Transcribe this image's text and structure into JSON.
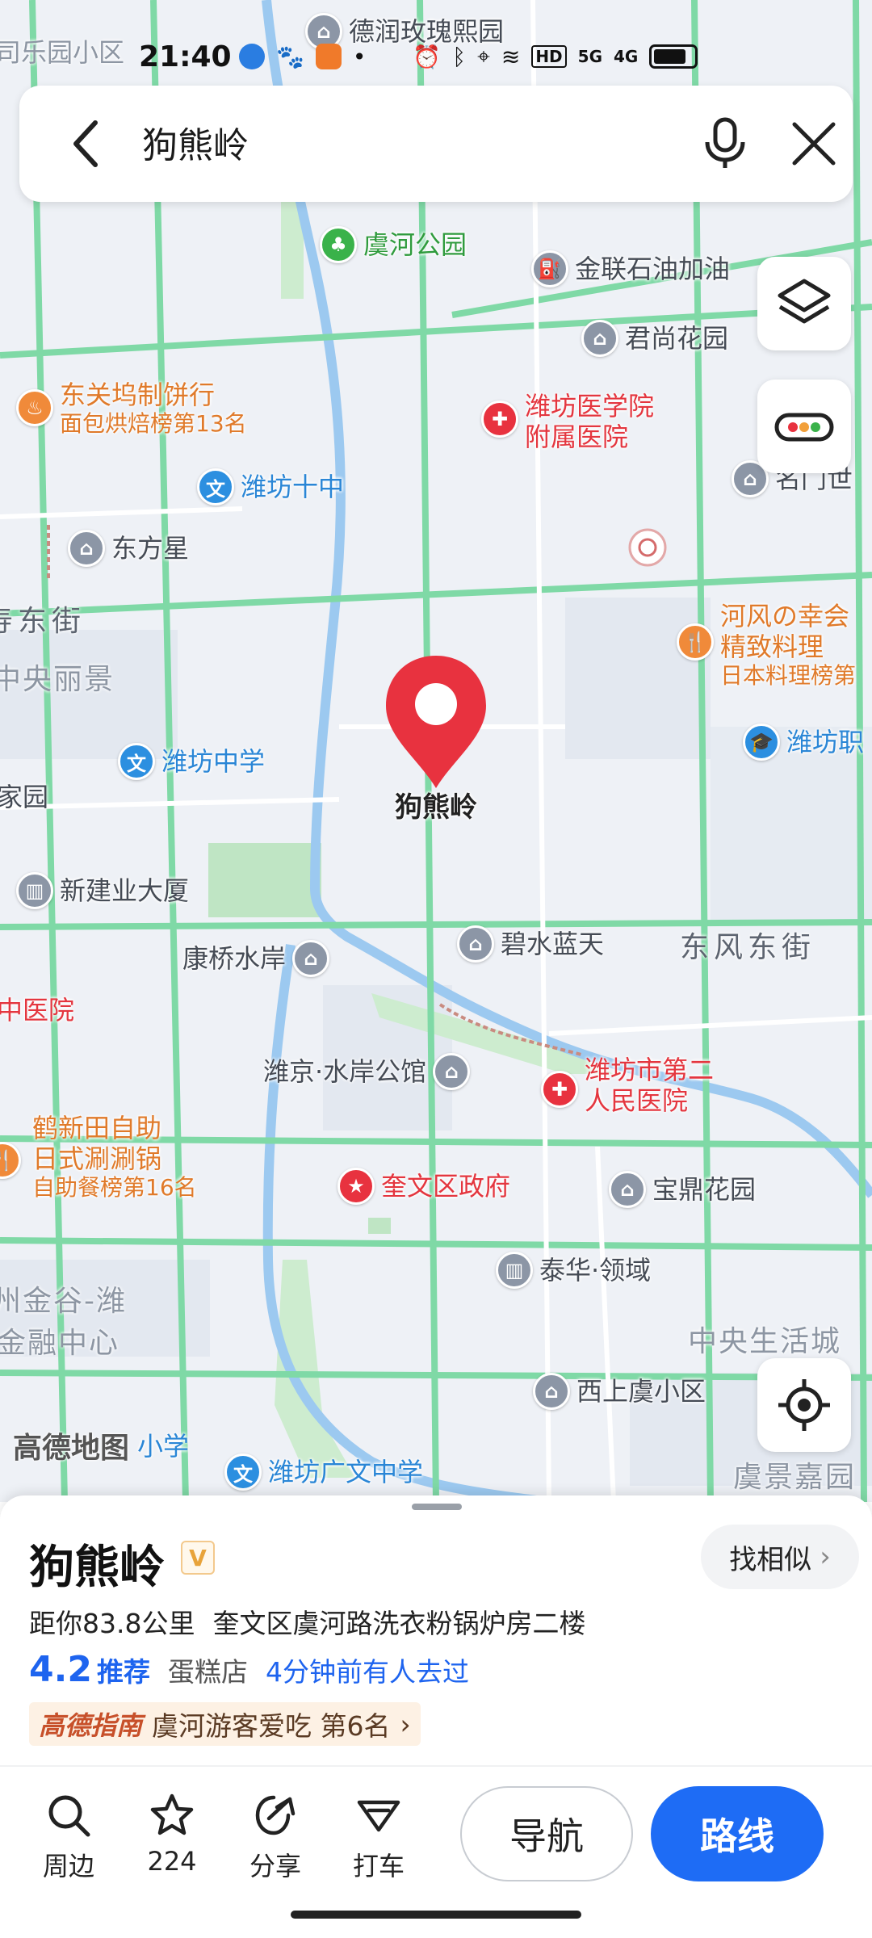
{
  "status_bar": {
    "time": "21:40",
    "icons": [
      "app-icon-1",
      "paw-icon",
      "app-icon-2",
      "dot-icon",
      "alarm-icon",
      "bluetooth-icon",
      "location-icon",
      "wifi-icon",
      "hd-icon",
      "signal-5g-icon",
      "signal-4g-icon",
      "battery-icon"
    ],
    "hd_label": "HD",
    "sig1_label": "5G",
    "sig2_label": "4G"
  },
  "search": {
    "query": "狗熊岭"
  },
  "map": {
    "pin_label": "狗熊岭",
    "watermark": "高德地图",
    "pois": [
      {
        "name": "德润玫瑰熙园"
      },
      {
        "name": "虞河公园"
      },
      {
        "name": "金联石油加油"
      },
      {
        "name": "君尚花园"
      },
      {
        "name": "东关坞制饼行",
        "sub": "面包烘焙榜第13名"
      },
      {
        "name": "潍坊医学院",
        "sub": "附属医院"
      },
      {
        "name": "潍坊十中"
      },
      {
        "name": "名门世"
      },
      {
        "name": "东方星"
      },
      {
        "name": "河风の幸会",
        "sub": "精致料理",
        "sub2": "日本料理榜第"
      },
      {
        "name": "潍坊中学"
      },
      {
        "name": "潍坊职"
      },
      {
        "name": "新建业大厦"
      },
      {
        "name": "康桥水岸"
      },
      {
        "name": "碧水蓝天"
      },
      {
        "name": "潍京·水岸公馆"
      },
      {
        "name": "潍坊市第二",
        "sub": "人民医院"
      },
      {
        "name": "中医院"
      },
      {
        "name": "鹤新田自助",
        "sub": "日式涮涮锅",
        "sub2": "自助餐榜第16名"
      },
      {
        "name": "奎文区政府"
      },
      {
        "name": "宝鼎花园"
      },
      {
        "name": "泰华·领域"
      },
      {
        "name": "西上虞小区"
      },
      {
        "name": "潍坊广文中学"
      },
      {
        "name": "小学"
      }
    ],
    "areas": [
      "司乐园小区",
      "中央丽景",
      "家园",
      "州金谷-潍",
      "金融中心",
      "中央生活城",
      "虞景嘉园",
      "寿东街"
    ],
    "streets": [
      "东风东街"
    ]
  },
  "place": {
    "title": "狗熊岭",
    "badge": "V",
    "similar_label": "找相似",
    "distance": "距你83.8公里",
    "address": "奎文区虞河路洗衣粉锅炉房二楼",
    "score": "4.2",
    "recommend": "推荐",
    "category": "蛋糕店",
    "visited": "4分钟前有人去过",
    "rank_brand": "高德指南",
    "rank_text": "虞河游客爱吃 第6名"
  },
  "actions": [
    {
      "label": "周边",
      "icon": "search-icon"
    },
    {
      "label": "224",
      "icon": "star-icon"
    },
    {
      "label": "分享",
      "icon": "share-icon"
    },
    {
      "label": "打车",
      "icon": "taxi-icon"
    }
  ],
  "nav_label": "导航",
  "route_label": "路线",
  "colors": {
    "accent": "#1e6cf5",
    "pin": "#e8323f",
    "road": "#7fd9a6",
    "river": "#9cc9f0"
  }
}
